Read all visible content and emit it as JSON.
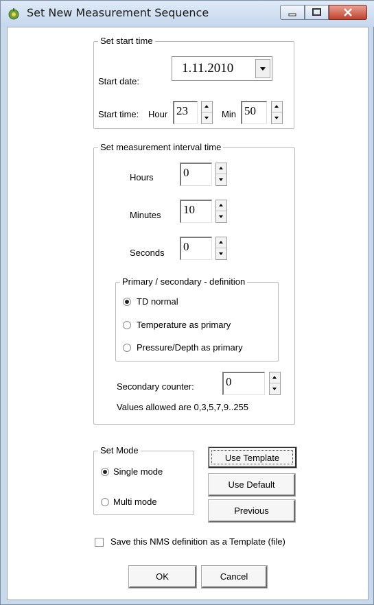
{
  "window": {
    "title": "Set New Measurement Sequence"
  },
  "start_group": {
    "legend": "Set start time",
    "date_label": "Start date:",
    "date_value": "1.11.2010",
    "time_label": "Start time:",
    "hour_label": "Hour",
    "hour_value": "23",
    "min_label": "Min",
    "min_value": "50"
  },
  "interval_group": {
    "legend": "Set measurement interval time",
    "hours_label": "Hours",
    "hours_value": "0",
    "minutes_label": "Minutes",
    "minutes_value": "10",
    "seconds_label": "Seconds",
    "seconds_value": "0",
    "definition": {
      "legend": "Primary / secondary - definition",
      "options": [
        "TD normal",
        "Temperature as primary",
        "Pressure/Depth as primary"
      ],
      "selected": "TD normal"
    },
    "secondary_label": "Secondary counter:",
    "secondary_value": "0",
    "allowed_text": "Values allowed are 0,3,5,7,9..255"
  },
  "mode_group": {
    "legend": "Set Mode",
    "options": [
      "Single mode",
      "Multi mode"
    ],
    "selected": "Single mode"
  },
  "buttons": {
    "use_template": "Use Template",
    "use_default": "Use Default",
    "previous": "Previous",
    "ok": "OK",
    "cancel": "Cancel"
  },
  "save_template_label": "Save this NMS definition as a Template (file)",
  "save_template_checked": false,
  "colors": {
    "titlebar": "#c9d9ec",
    "close_button": "#c2422c"
  }
}
